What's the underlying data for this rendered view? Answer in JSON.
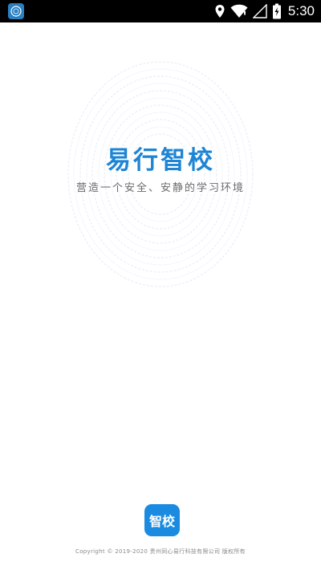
{
  "status_bar": {
    "time": "5:30",
    "icons": [
      "app-notification-icon",
      "location-icon",
      "wifi-icon",
      "cellular-signal-icon",
      "battery-charging-icon"
    ]
  },
  "splash": {
    "title": "易行智校",
    "tagline": "营造一个安全、安静的学习环境"
  },
  "footer": {
    "logo_text": "智校",
    "copyright": "Copyright © 2019-2020 贵州同心易行科技有限公司 版权所有"
  },
  "colors": {
    "brand_blue": "#1e84d4",
    "logo_blue": "#1a8be0",
    "status_bar": "#000000"
  }
}
